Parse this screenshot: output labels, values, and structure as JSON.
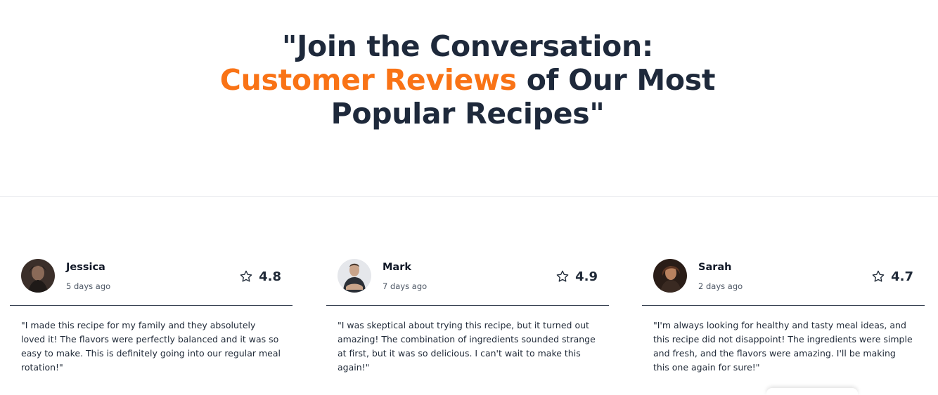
{
  "header": {
    "title_part1": "\"Join the Conversation:",
    "title_accent": "Customer Reviews",
    "title_part2": " of Our Most Popular Recipes\""
  },
  "colors": {
    "accent": "#f97316",
    "heading": "#1e293b",
    "divider": "#374151"
  },
  "reviews": [
    {
      "name": "Jessica",
      "time": "5 days ago",
      "rating": "4.8",
      "rating_icon": "star-outline-icon",
      "avatar_icon": "avatar-photo",
      "text": "\"I made this recipe for my family and they absolutely loved it! The flavors were perfectly balanced and it was so easy to make. This is definitely going into our regular meal rotation!\""
    },
    {
      "name": "Mark",
      "time": "7 days ago",
      "rating": "4.9",
      "rating_icon": "star-outline-icon",
      "avatar_icon": "avatar-photo",
      "text": "\"I was skeptical about trying this recipe, but it turned out amazing! The combination of ingredients sounded strange at first, but it was so delicious. I can't wait to make this again!\""
    },
    {
      "name": "Sarah",
      "time": "2 days ago",
      "rating": "4.7",
      "rating_icon": "star-outline-icon",
      "avatar_icon": "avatar-photo",
      "text": "\"I'm always looking for healthy and tasty meal ideas, and this recipe did not disappoint! The ingredients were simple and fresh, and the flavors were amazing. I'll be making this one again for sure!\""
    }
  ]
}
